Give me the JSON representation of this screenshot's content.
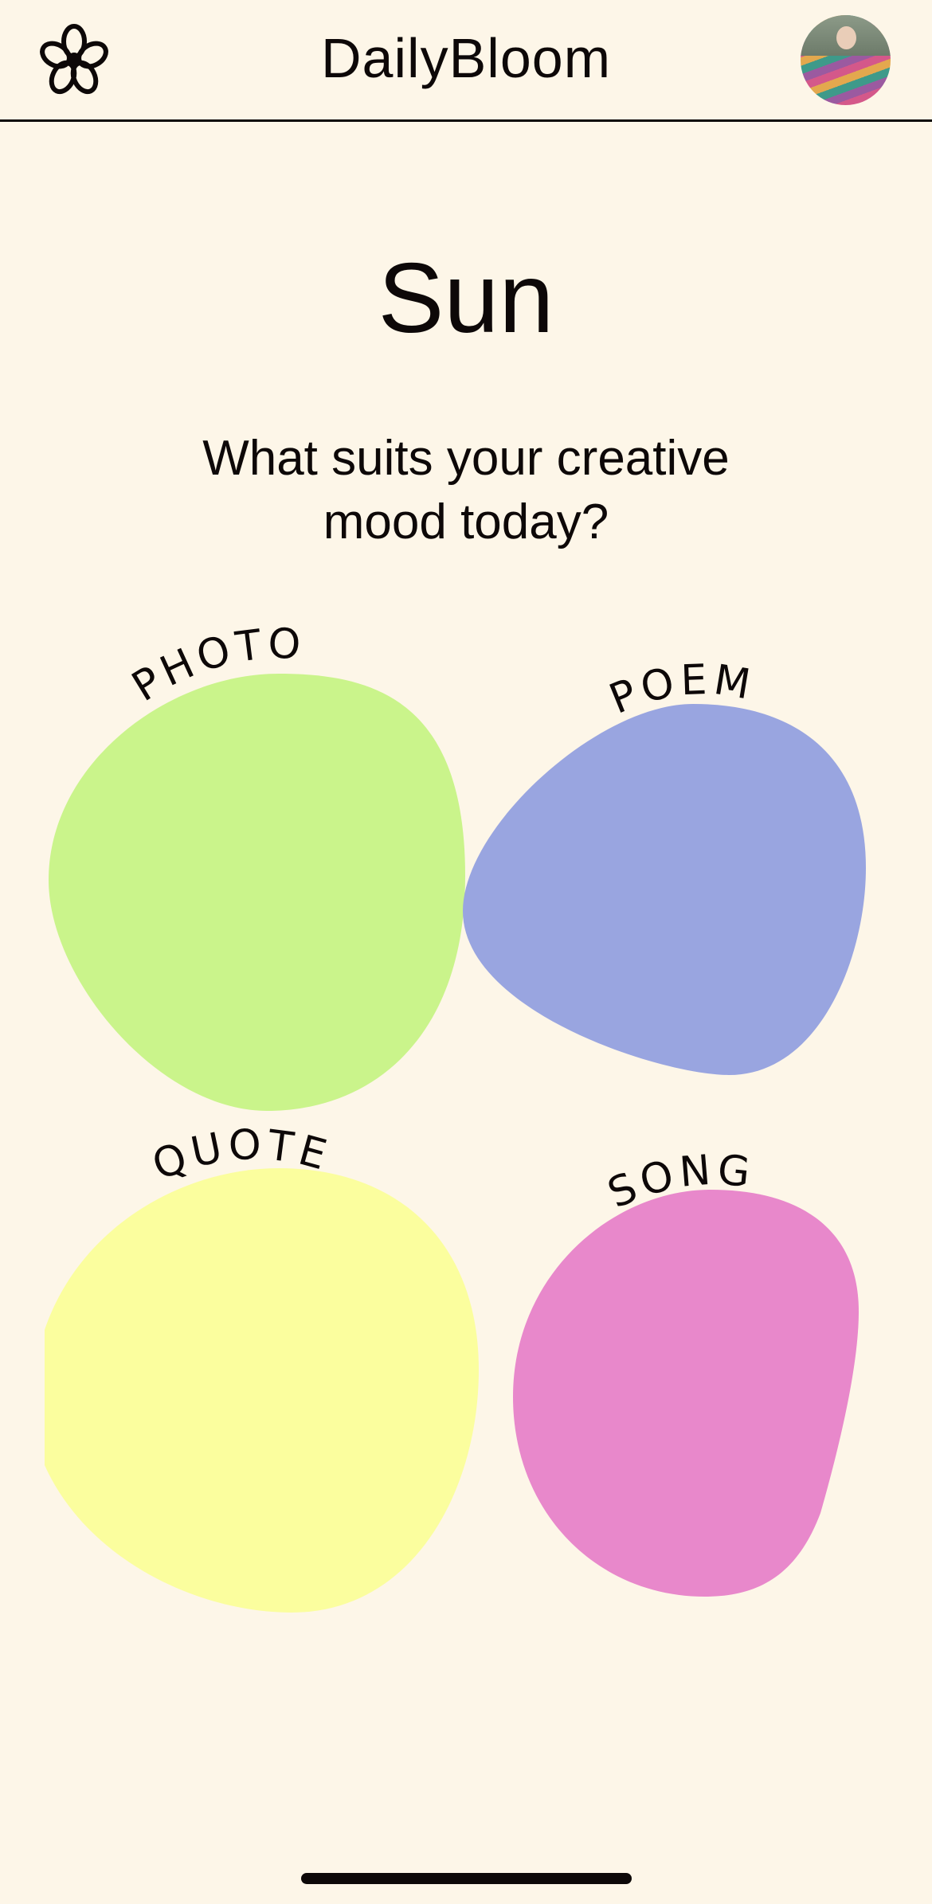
{
  "header": {
    "title": "DailyBloom",
    "logo_icon": "flower-icon",
    "avatar_icon": "user-avatar"
  },
  "main": {
    "day": "Sun",
    "question": "What suits your creative mood today?",
    "options": [
      {
        "label": "PHOTO",
        "color": "#caf48b"
      },
      {
        "label": "POEM",
        "color": "#99a5e0"
      },
      {
        "label": "QUOTE",
        "color": "#fbfe9e"
      },
      {
        "label": "SONG",
        "color": "#e888cb"
      }
    ]
  }
}
